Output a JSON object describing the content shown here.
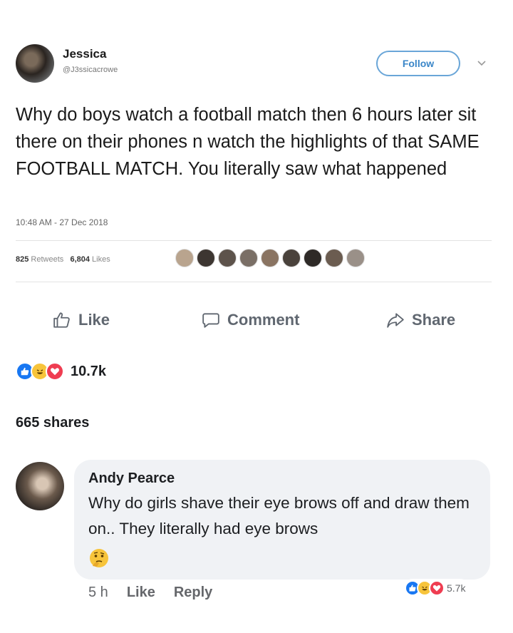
{
  "tweet": {
    "name": "Jessica",
    "handle": "@J3ssicacrowe",
    "follow_label": "Follow",
    "text": "Why do boys watch a football match then 6 hours later sit there on their phones n watch the highlights of that SAME FOOTBALL MATCH. You literally saw what happened",
    "timestamp": "10:48 AM - 27 Dec 2018",
    "retweets": "825",
    "retweets_label": "Retweets",
    "likes": "6,804",
    "likes_label": "Likes"
  },
  "actions": {
    "like": "Like",
    "comment": "Comment",
    "share": "Share"
  },
  "post": {
    "reaction_count": "10.7k",
    "shares": "665 shares"
  },
  "comment": {
    "author": "Andy Pearce",
    "text": "Why do girls shave their eye brows off and draw them on.. They literally had eye brows",
    "time": "5 h",
    "like": "Like",
    "reply": "Reply",
    "reaction_count": "5.7k"
  },
  "icons": {
    "like": "thumbs-up-icon",
    "comment": "speech-bubble-icon",
    "share": "share-arrow-icon",
    "chevron": "chevron-down-icon"
  },
  "colors": {
    "facebook_blue": "#1877f2",
    "haha_yellow": "#f7c43b",
    "love_red": "#ef3d51",
    "twitter_blue": "#3a86c8"
  }
}
